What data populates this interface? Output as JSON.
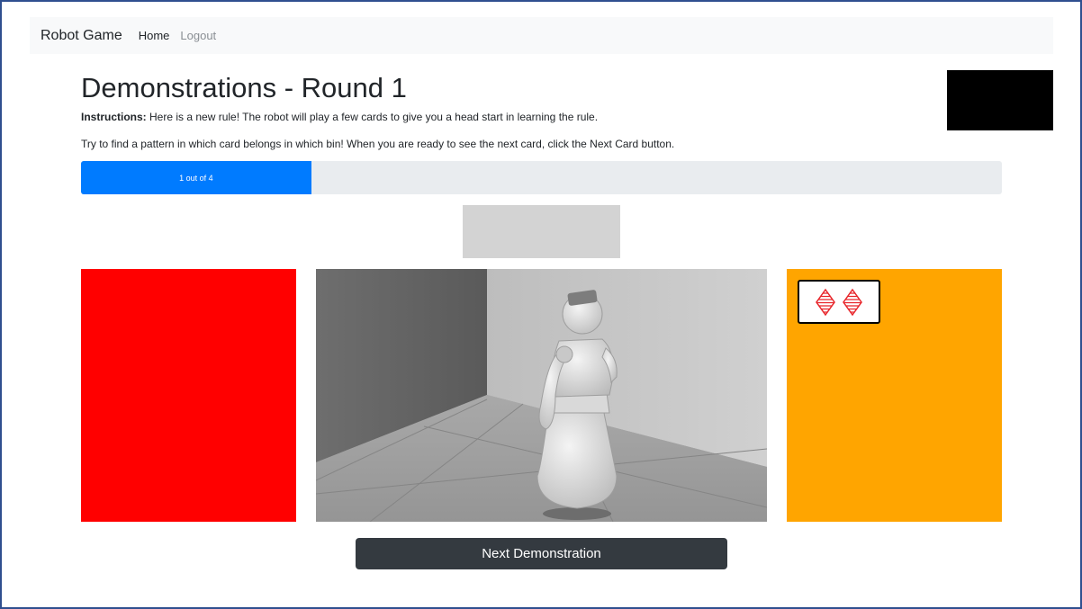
{
  "navbar": {
    "brand": "Robot Game",
    "links": [
      {
        "label": "Home",
        "active": true
      },
      {
        "label": "Logout",
        "active": false
      }
    ]
  },
  "main": {
    "title": "Demonstrations - Round 1",
    "instructions_label": "Instructions:",
    "instructions_text": " Here is a new rule! The robot will play a few cards to give you a head start in learning the rule.",
    "instructions_line2": "Try to find a pattern in which card belongs in which bin! When you are ready to see the next card, click the Next Card button.",
    "progress": {
      "text": "1 out of 4",
      "current": 1,
      "total": 4,
      "color": "#007bff"
    },
    "bins": [
      {
        "color": "#ff0000",
        "cards": []
      },
      {
        "color": "#ffa500",
        "cards": [
          {
            "shape": "diamond",
            "count": 2,
            "color": "#e8252a",
            "fill": "striped"
          }
        ]
      }
    ],
    "scene_icon": "robot-simulation-view",
    "next_button_label": "Next Demonstration"
  }
}
